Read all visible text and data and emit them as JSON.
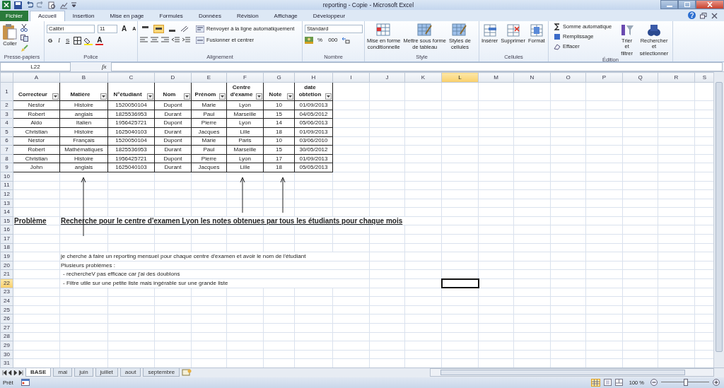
{
  "window": {
    "title": "reporting - Copie - Microsoft Excel"
  },
  "ribbon_tabs": [
    {
      "label": "Fichier",
      "kind": "file",
      "selected": false
    },
    {
      "label": "Accueil",
      "kind": "tab",
      "selected": true
    },
    {
      "label": "Insertion",
      "kind": "tab",
      "selected": false
    },
    {
      "label": "Mise en page",
      "kind": "tab",
      "selected": false
    },
    {
      "label": "Formules",
      "kind": "tab",
      "selected": false
    },
    {
      "label": "Données",
      "kind": "tab",
      "selected": false
    },
    {
      "label": "Révision",
      "kind": "tab",
      "selected": false
    },
    {
      "label": "Affichage",
      "kind": "tab",
      "selected": false
    },
    {
      "label": "Développeur",
      "kind": "tab",
      "selected": false
    }
  ],
  "clipboard": {
    "label": "Presse-papiers",
    "paste": "Coller"
  },
  "font": {
    "label": "Police",
    "family": "Calibri",
    "size": "11",
    "grow": "A",
    "shrink": "A",
    "bold": "G",
    "italic": "I",
    "underline": "S",
    "color_letter": "A"
  },
  "alignment": {
    "label": "Alignement",
    "vertical": [
      {
        "selected": false
      },
      {
        "selected": true
      },
      {
        "selected": false
      }
    ],
    "wrap": "Renvoyer à la ligne automatiquement",
    "merge": "Fusionner et centrer"
  },
  "number": {
    "label": "Nombre",
    "format": "Standard",
    "percent": "%",
    "thousands": "000"
  },
  "styles": {
    "label": "Style",
    "buttons": [
      {
        "lines": [
          "Mise en forme",
          "conditionnelle"
        ]
      },
      {
        "lines": [
          "Mettre sous forme",
          "de tableau"
        ]
      },
      {
        "lines": [
          "Styles de",
          "cellules"
        ]
      }
    ]
  },
  "cells": {
    "label": "Cellules",
    "buttons": [
      "Insérer",
      "Supprimer",
      "Format"
    ]
  },
  "editing": {
    "label": "Édition",
    "small": [
      "Somme automatique",
      "Remplissage",
      "Effacer"
    ],
    "large": [
      {
        "lines": [
          "Trier et",
          "filtrer"
        ]
      },
      {
        "lines": [
          "Rechercher et",
          "sélectionner"
        ]
      }
    ]
  },
  "formula_bar": {
    "name_box": "L22",
    "fx": "fx"
  },
  "sheet": {
    "columns": [
      {
        "label": "A",
        "selected": false
      },
      {
        "label": "B",
        "selected": false
      },
      {
        "label": "C",
        "selected": false
      },
      {
        "label": "D",
        "selected": false
      },
      {
        "label": "E",
        "selected": false
      },
      {
        "label": "F",
        "selected": false
      },
      {
        "label": "G",
        "selected": false
      },
      {
        "label": "H",
        "selected": false
      },
      {
        "label": "I",
        "selected": false
      },
      {
        "label": "J",
        "selected": false
      },
      {
        "label": "K",
        "selected": false
      },
      {
        "label": "L",
        "selected": true
      },
      {
        "label": "M",
        "selected": false
      },
      {
        "label": "N",
        "selected": false
      },
      {
        "label": "O",
        "selected": false
      },
      {
        "label": "P",
        "selected": false
      },
      {
        "label": "Q",
        "selected": false
      },
      {
        "label": "R",
        "selected": false
      },
      {
        "label": "S",
        "selected": false
      }
    ],
    "rows": [
      {
        "label": "1",
        "selected": false
      },
      {
        "label": "2",
        "selected": false
      },
      {
        "label": "3",
        "selected": false
      },
      {
        "label": "4",
        "selected": false
      },
      {
        "label": "5",
        "selected": false
      },
      {
        "label": "6",
        "selected": false
      },
      {
        "label": "7",
        "selected": false
      },
      {
        "label": "8",
        "selected": false
      },
      {
        "label": "9",
        "selected": false
      },
      {
        "label": "10",
        "selected": false
      },
      {
        "label": "11",
        "selected": false
      },
      {
        "label": "12",
        "selected": false
      },
      {
        "label": "13",
        "selected": false
      },
      {
        "label": "14",
        "selected": false
      },
      {
        "label": "15",
        "selected": false
      },
      {
        "label": "16",
        "selected": false
      },
      {
        "label": "17",
        "selected": false
      },
      {
        "label": "18",
        "selected": false
      },
      {
        "label": "19",
        "selected": false
      },
      {
        "label": "20",
        "selected": false
      },
      {
        "label": "21",
        "selected": false
      },
      {
        "label": "22",
        "selected": true
      },
      {
        "label": "23",
        "selected": false
      },
      {
        "label": "24",
        "selected": false
      },
      {
        "label": "25",
        "selected": false
      },
      {
        "label": "26",
        "selected": false
      },
      {
        "label": "27",
        "selected": false
      },
      {
        "label": "28",
        "selected": false
      },
      {
        "label": "29",
        "selected": false
      },
      {
        "label": "30",
        "selected": false
      },
      {
        "label": "31",
        "selected": false
      }
    ]
  },
  "table": {
    "headers": [
      "Correcteur",
      "Matière",
      "N°étudiant",
      "Nom",
      "Prénom",
      "Centre d'exame",
      "Note",
      "date obtetion"
    ],
    "rows": [
      [
        "Nestor",
        "Histoire",
        "1520050104",
        "Dupont",
        "Marie",
        "Lyon",
        "10",
        "01/09/2013"
      ],
      [
        "Robert",
        "anglais",
        "1825536953",
        "Durant",
        "Paul",
        "Marseille",
        "15",
        "04/05/2012"
      ],
      [
        "Aldo",
        "Italien",
        "1956425721",
        "Dupont",
        "Pierre",
        "Lyon",
        "14",
        "05/06/2013"
      ],
      [
        "Christian",
        "Histoire",
        "1625040103",
        "Durant",
        "Jacques",
        "Lille",
        "18",
        "01/09/2013"
      ],
      [
        "Nestor",
        "Français",
        "1520050104",
        "Dupont",
        "Marie",
        "Paris",
        "10",
        "03/06/2010"
      ],
      [
        "Robert",
        "Mathématiques",
        "1825536953",
        "Durant",
        "Paul",
        "Marseille",
        "15",
        "30/05/2012"
      ],
      [
        "Christian",
        "Histoire",
        "1956425721",
        "Dupont",
        "Pierre",
        "Lyon",
        "17",
        "01/09/2013"
      ],
      [
        "John",
        "anglais",
        "1625040103",
        "Durant",
        "Jacques",
        "Lille",
        "18",
        "05/05/2013"
      ]
    ]
  },
  "problem": {
    "label": "Problème",
    "title": "Recherche pour le centre d'examen Lyon les notes obtenues par tous les étudiants pour chaque mois"
  },
  "description": [
    {
      "kind": "line",
      "text": "je cherche à faire un reporting mensuel pour chaque centre d'examen et avoir le nom de l'étudiant"
    },
    {
      "kind": "line",
      "text": "Plusieurs problèmes :"
    },
    {
      "kind": "bullet",
      "text": "- rechercheV pas efficace car j'ai des doublons"
    },
    {
      "kind": "bullet",
      "text": "- Filtre utile sur une petite liste mais ingérable sur une grande liste"
    }
  ],
  "sheet_tabs": [
    {
      "label": "BASE",
      "selected": true
    },
    {
      "label": "mai",
      "selected": false
    },
    {
      "label": "juin",
      "selected": false
    },
    {
      "label": "juillet",
      "selected": false
    },
    {
      "label": "aout",
      "selected": false
    },
    {
      "label": "septembre",
      "selected": false
    }
  ],
  "status_bar": {
    "status": "Prêt",
    "zoom": "100 %"
  },
  "zoom_slider": {
    "level": 0.5
  }
}
